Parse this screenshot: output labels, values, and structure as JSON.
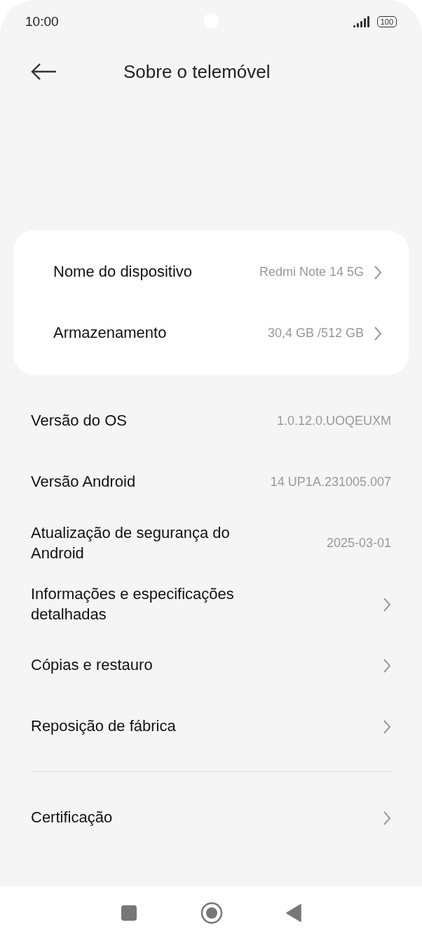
{
  "status_bar": {
    "time": "10:00",
    "battery": "100"
  },
  "header": {
    "title": "Sobre o telemóvel"
  },
  "card": [
    {
      "label": "Nome do dispositivo",
      "value": "Redmi Note 14 5G",
      "kind": "link"
    },
    {
      "label": "Armazenamento",
      "value": "30,4 GB /512 GB",
      "kind": "link"
    }
  ],
  "groups": [
    [
      {
        "label": "Versão do OS",
        "value": "1.0.12.0.UOQEUXM",
        "kind": "info"
      },
      {
        "label": "Versão Android",
        "value": "14 UP1A.231005.007",
        "kind": "info"
      },
      {
        "label": "Atualização de segurança do Android",
        "value": "2025-03-01",
        "kind": "info"
      },
      {
        "label": "Informações e especificações detalhadas",
        "kind": "link"
      },
      {
        "label": "Cópias e restauro",
        "kind": "link"
      },
      {
        "label": "Reposição de fábrica",
        "kind": "link"
      }
    ],
    [
      {
        "label": "Certificação",
        "kind": "link"
      }
    ]
  ]
}
